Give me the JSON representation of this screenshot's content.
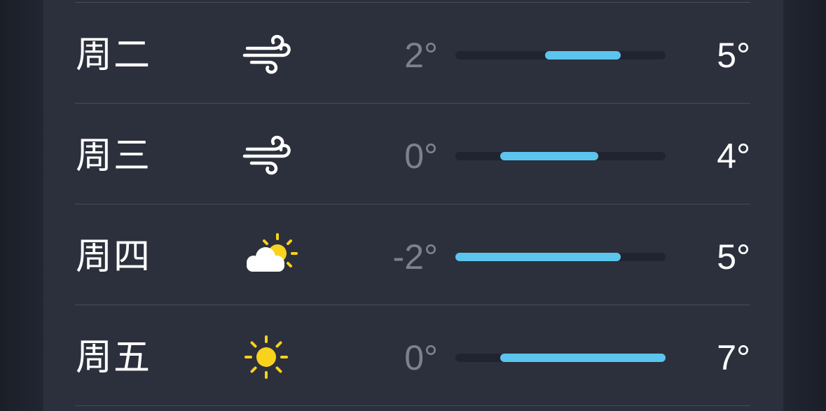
{
  "forecast": {
    "range_min": -2,
    "range_max": 7,
    "days": [
      {
        "day": "周二",
        "icon": "wind-icon",
        "low": "2°",
        "high": "5°",
        "low_value": 2,
        "high_value": 5
      },
      {
        "day": "周三",
        "icon": "wind-icon",
        "low": "0°",
        "high": "4°",
        "low_value": 0,
        "high_value": 4
      },
      {
        "day": "周四",
        "icon": "partly-sunny-icon",
        "low": "-2°",
        "high": "5°",
        "low_value": -2,
        "high_value": 5
      },
      {
        "day": "周五",
        "icon": "sun-icon",
        "low": "0°",
        "high": "7°",
        "low_value": 0,
        "high_value": 7
      }
    ]
  },
  "colors": {
    "bar_fill": "#5bc5ee",
    "sun": "#f9d21e",
    "card": "#2c303c"
  }
}
